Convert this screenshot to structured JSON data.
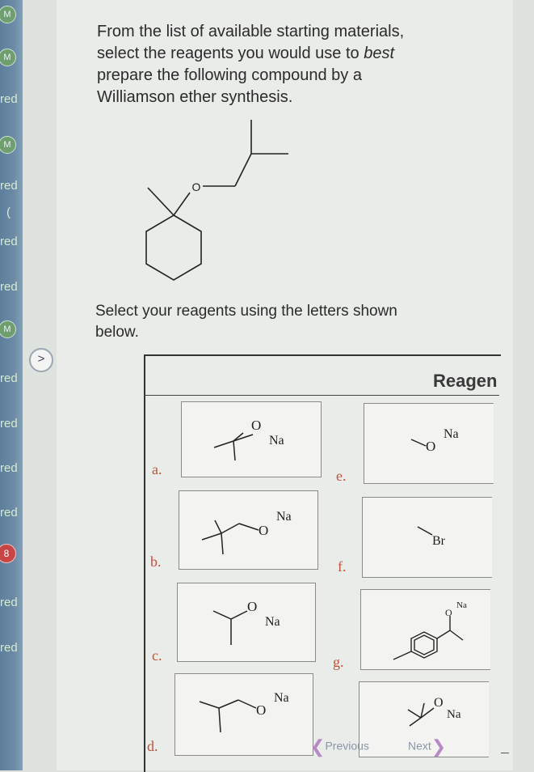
{
  "sidebar": {
    "items": [
      {
        "kind": "badge",
        "label": "M"
      },
      {
        "kind": "badge",
        "label": "M"
      },
      {
        "kind": "text",
        "label": "red"
      },
      {
        "kind": "badge",
        "label": "M"
      },
      {
        "kind": "text",
        "label": "red"
      },
      {
        "kind": "text",
        "label": "("
      },
      {
        "kind": "text",
        "label": "red"
      },
      {
        "kind": "text",
        "label": "red"
      },
      {
        "kind": "badge",
        "label": "M"
      },
      {
        "kind": "text",
        "label": "red"
      },
      {
        "kind": "text",
        "label": "red"
      },
      {
        "kind": "text",
        "label": "red"
      },
      {
        "kind": "text",
        "label": "red"
      },
      {
        "kind": "red",
        "label": "8"
      },
      {
        "kind": "text",
        "label": "red"
      },
      {
        "kind": "text",
        "label": "red"
      }
    ],
    "expand_icon": ">"
  },
  "question": {
    "line1": "From the list of available starting materials,",
    "line2_pre": "select the reagents you would use to ",
    "line2_em": "best",
    "line3": "prepare the following compound by a",
    "line4": "Williamson ether synthesis.",
    "target_atom_label": "O"
  },
  "select_prompt": {
    "line1": "Select your reagents using the letters shown",
    "line2": "below."
  },
  "table": {
    "header": "Reagen",
    "reagents": [
      {
        "letter": "a.",
        "labels": [
          "O",
          "Na"
        ]
      },
      {
        "letter": "b.",
        "labels": [
          "O",
          "Na"
        ]
      },
      {
        "letter": "c.",
        "labels": [
          "O",
          "Na"
        ]
      },
      {
        "letter": "d.",
        "labels": [
          "O",
          "Na"
        ]
      },
      {
        "letter": "e.",
        "labels": [
          "O",
          "Na"
        ]
      },
      {
        "letter": "f.",
        "labels": [
          "Br"
        ]
      },
      {
        "letter": "g.",
        "labels": [
          "O",
          "Na"
        ]
      },
      {
        "letter": "",
        "labels": [
          "O",
          "Na"
        ]
      }
    ]
  },
  "nav": {
    "previous": "Previous",
    "next": "Next"
  }
}
